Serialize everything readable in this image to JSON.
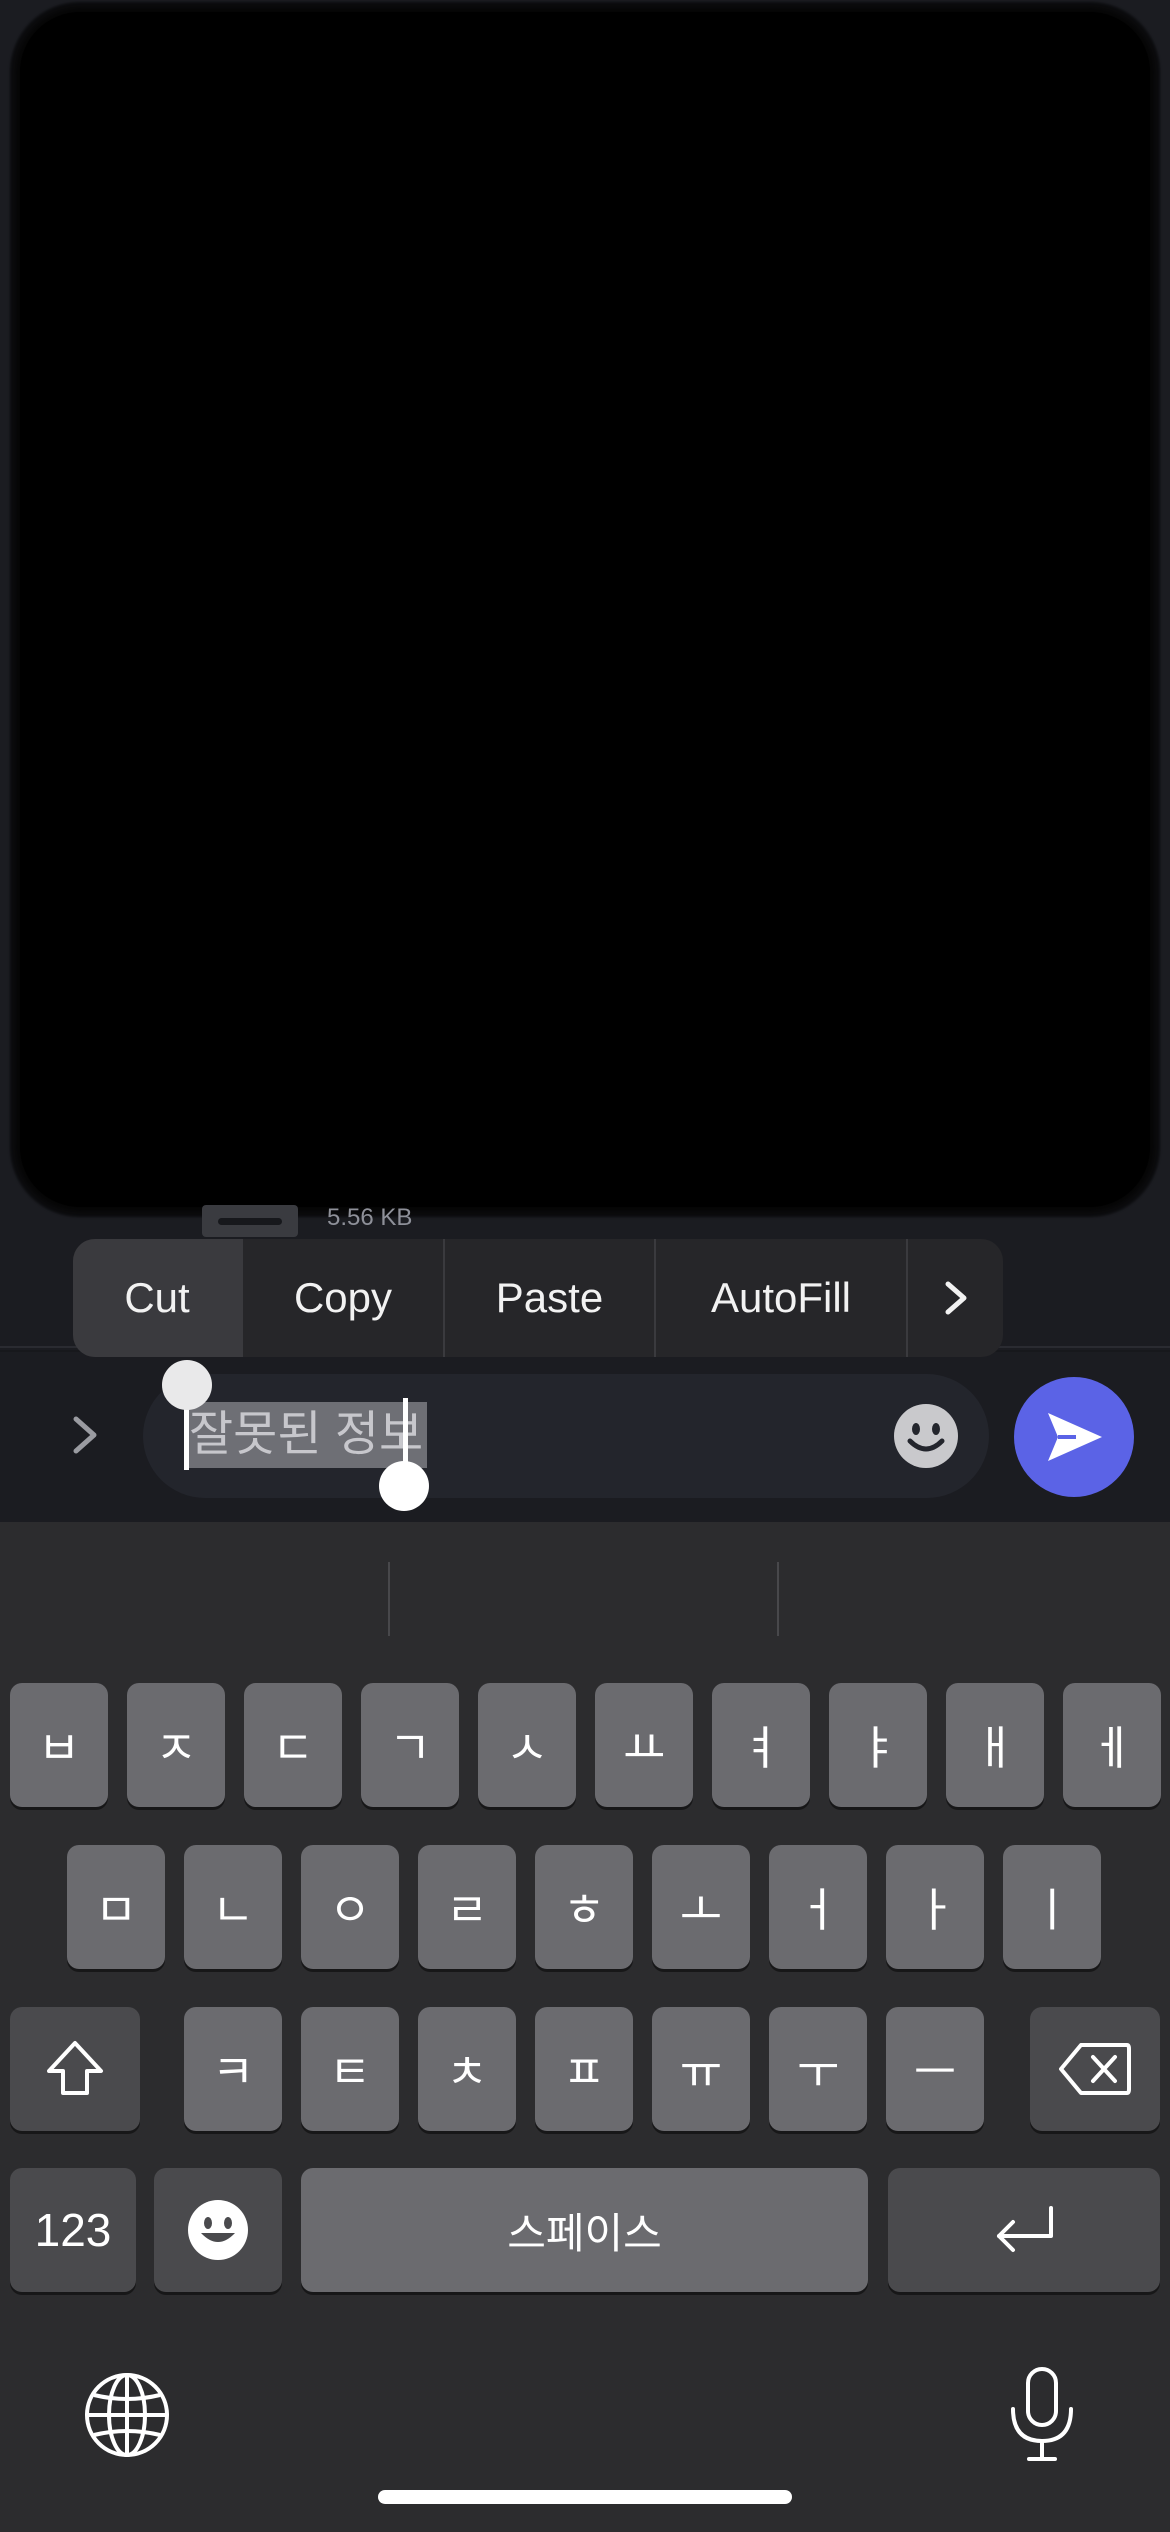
{
  "media": {
    "size_label": "5.56 KB"
  },
  "edit_menu": {
    "items": [
      {
        "label": "Cut"
      },
      {
        "label": "Copy"
      },
      {
        "label": "Paste"
      },
      {
        "label": "AutoFill"
      }
    ],
    "more_icon": "chevron-right-icon"
  },
  "input": {
    "selected_text": "잘못된 정보"
  },
  "keyboard": {
    "row1": [
      "ㅂ",
      "ㅈ",
      "ㄷ",
      "ㄱ",
      "ㅅ",
      "ㅛ",
      "ㅕ",
      "ㅑ",
      "ㅐ",
      "ㅔ"
    ],
    "row2": [
      "ㅁ",
      "ㄴ",
      "ㅇ",
      "ㄹ",
      "ㅎ",
      "ㅗ",
      "ㅓ",
      "ㅏ",
      "ㅣ"
    ],
    "row3": [
      "ㅋ",
      "ㅌ",
      "ㅊ",
      "ㅍ",
      "ㅠ",
      "ㅜ",
      "ㅡ"
    ],
    "numbers_label": "123",
    "space_label": "스페이스"
  },
  "colors": {
    "send_button": "#5b63e6",
    "key": "#6b6b6f",
    "key_dark": "#4a4a4d"
  }
}
